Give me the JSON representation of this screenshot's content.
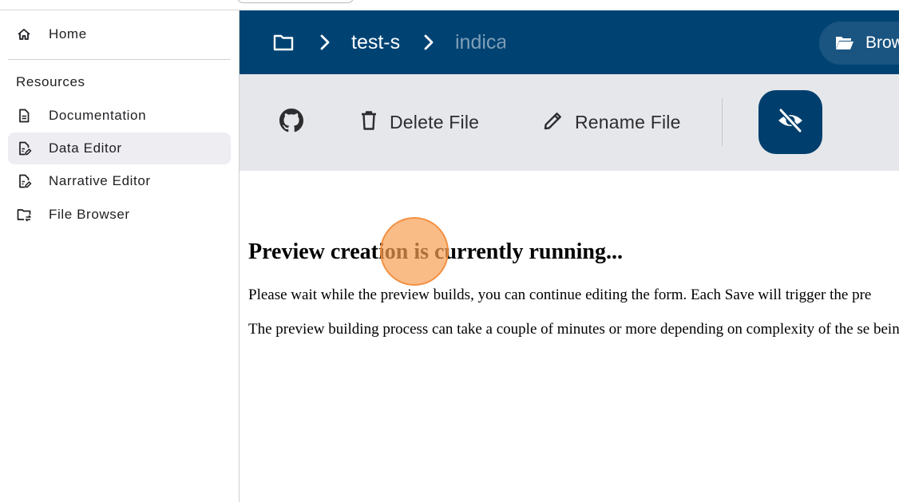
{
  "sidebar": {
    "home_label": "Home",
    "section_label": "Resources",
    "items": [
      {
        "label": "Documentation",
        "icon": "document-icon"
      },
      {
        "label": "Data Editor",
        "icon": "edit-document-icon",
        "active": true
      },
      {
        "label": "Narrative Editor",
        "icon": "edit-document-icon"
      },
      {
        "label": "File Browser",
        "icon": "folder-sync-icon"
      }
    ]
  },
  "header": {
    "breadcrumb": [
      "test-s",
      "indica"
    ],
    "browse_label": "Brow"
  },
  "toolbar": {
    "delete_label": "Delete File",
    "rename_label": "Rename File"
  },
  "content": {
    "title": "Preview creation is currently running...",
    "paragraph1": "Please wait while the preview builds, you can continue editing the form. Each Save will trigger the pre",
    "paragraph2": "The preview building process can take a couple of minutes or more depending on complexity of the se being build."
  },
  "colors": {
    "header_bg": "#004373",
    "toolbar_bg": "#e6e7ea",
    "active_item_bg": "#ededf2",
    "preview_toggle_bg": "#003f6d",
    "click_marker": "#f8a054"
  }
}
